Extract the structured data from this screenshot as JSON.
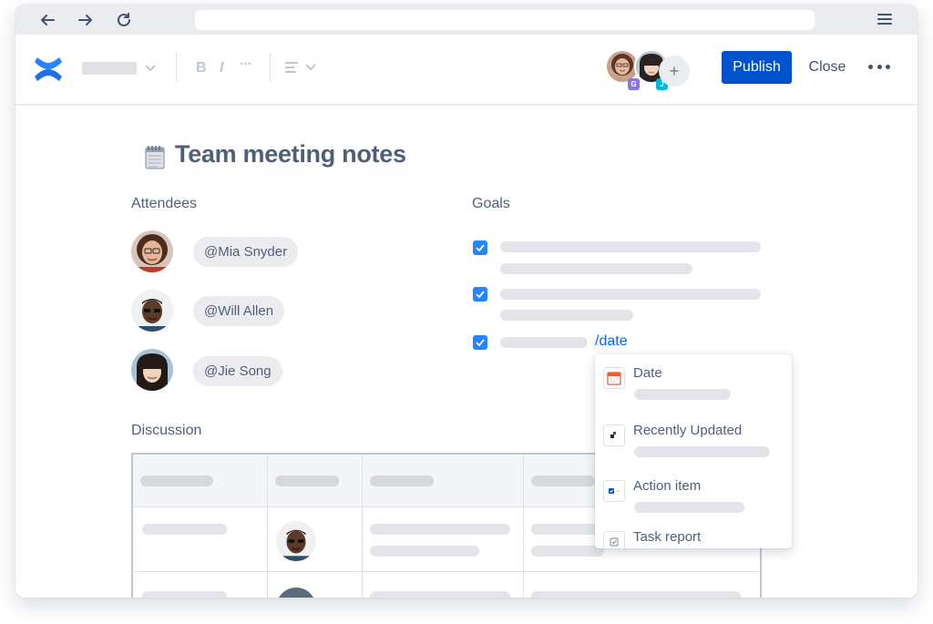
{
  "editor": {
    "publish_label": "Publish",
    "close_label": "Close",
    "collaborator_initials": [
      "G",
      "J"
    ]
  },
  "page": {
    "title": "Team meeting notes"
  },
  "attendees": {
    "heading": "Attendees",
    "people": [
      {
        "mention": "@Mia Snyder"
      },
      {
        "mention": "@Will Allen"
      },
      {
        "mention": "@Jie Song"
      }
    ]
  },
  "goals": {
    "heading": "Goals",
    "slash_command": "/date"
  },
  "discussion": {
    "heading": "Discussion"
  },
  "slash_menu": {
    "items": [
      {
        "label": "Date",
        "icon": "calendar-icon"
      },
      {
        "label": "Recently Updated",
        "icon": "recently-updated-icon"
      },
      {
        "label": "Action item",
        "icon": "action-item-icon"
      },
      {
        "label": "Task report",
        "icon": "task-report-icon"
      }
    ]
  },
  "colors": {
    "brand_blue": "#0052cc",
    "checkbox_blue": "#2684ff",
    "link_blue": "#0065ff",
    "badge_purple": "#8777d9",
    "badge_teal": "#00b8d9"
  }
}
